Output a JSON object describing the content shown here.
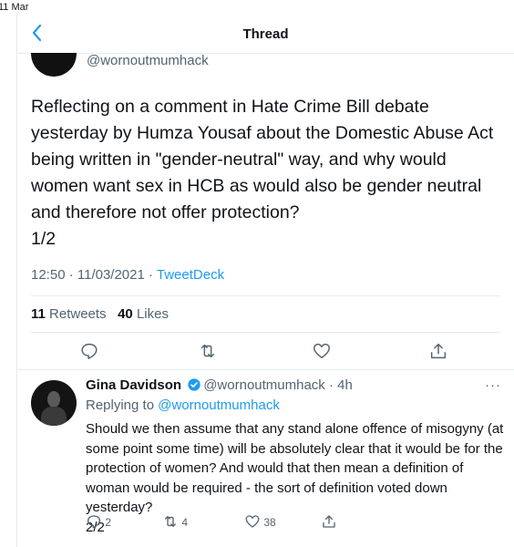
{
  "status_bar": {
    "date": "11 Mar"
  },
  "header": {
    "title": "Thread"
  },
  "main_tweet": {
    "handle": "@wornoutmumhack",
    "text": "Reflecting on a comment in Hate Crime Bill debate yesterday by Humza Yousaf about the Domestic Abuse Act being written in \"gender-neutral\" way, and why would women want sex in HCB as would also be gender neutral and therefore not offer protection?\n1/2",
    "time": "12:50 · 11/03/2021 · ",
    "source": "TweetDeck",
    "retweets": "11",
    "retweets_label": "Retweets",
    "likes": "40",
    "likes_label": "Likes"
  },
  "reply": {
    "name": "Gina Davidson",
    "handle": "@wornoutmumhack",
    "age": "· 4h",
    "replying_prefix": "Replying to ",
    "replying_to": "@wornoutmumhack",
    "text": "Should we then assume that any stand alone offence of misogyny (at some point some time) will be absolutely clear that it would be for the protection of women? And would that then mean a definition of woman would be required - the sort of definition voted down yesterday?\n2/2",
    "reply_count": "2",
    "retweet_count": "4",
    "like_count": "38",
    "more": "···"
  },
  "colors": {
    "accent": "#1d9bf0",
    "muted": "#536471",
    "border": "#e6ecf0",
    "text": "#0f1419"
  },
  "icons": [
    "back-chevron-icon",
    "reply-icon",
    "retweet-icon",
    "like-icon",
    "share-icon",
    "verified-icon",
    "more-icon"
  ]
}
